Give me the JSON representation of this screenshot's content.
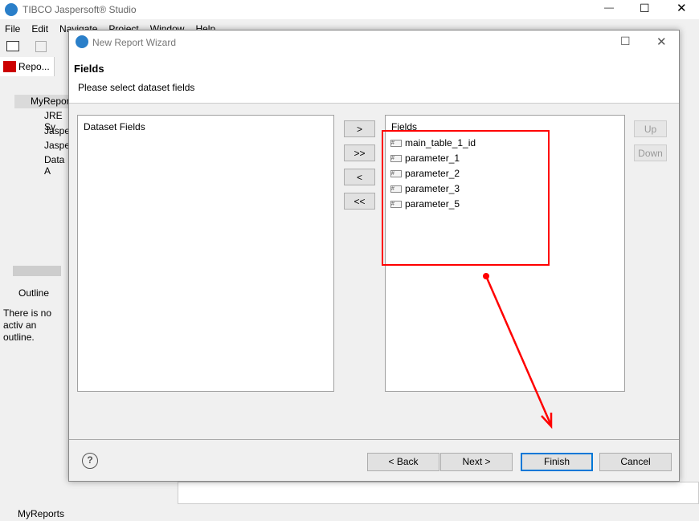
{
  "app": {
    "title": "TIBCO Jaspersoft® Studio",
    "menu": [
      "File",
      "Edit",
      "Navigate",
      "Project",
      "Window",
      "Help"
    ],
    "tab": "Repo...",
    "tree": [
      "MyRepor",
      "JRE Sy",
      "Jasper",
      "Jasper",
      "Data A"
    ],
    "outline_title": "Outline",
    "outline_text": "There is no activ an outline.",
    "status": "MyReports"
  },
  "dialog": {
    "title": "New Report Wizard",
    "heading": "Fields",
    "subtitle": "Please select dataset fields",
    "left_list_title": "Dataset Fields",
    "right_list_title": "Fields",
    "fields": [
      "main_table_1_id",
      "parameter_1",
      "parameter_2",
      "parameter_3",
      "parameter_5"
    ],
    "move_buttons": [
      ">",
      ">>",
      "<",
      "<<"
    ],
    "up": "Up",
    "down": "Down",
    "back": "< Back",
    "next": "Next >",
    "finish": "Finish",
    "cancel": "Cancel"
  },
  "colors": {
    "annotation": "#ff0000",
    "focus": "#0078d7"
  }
}
